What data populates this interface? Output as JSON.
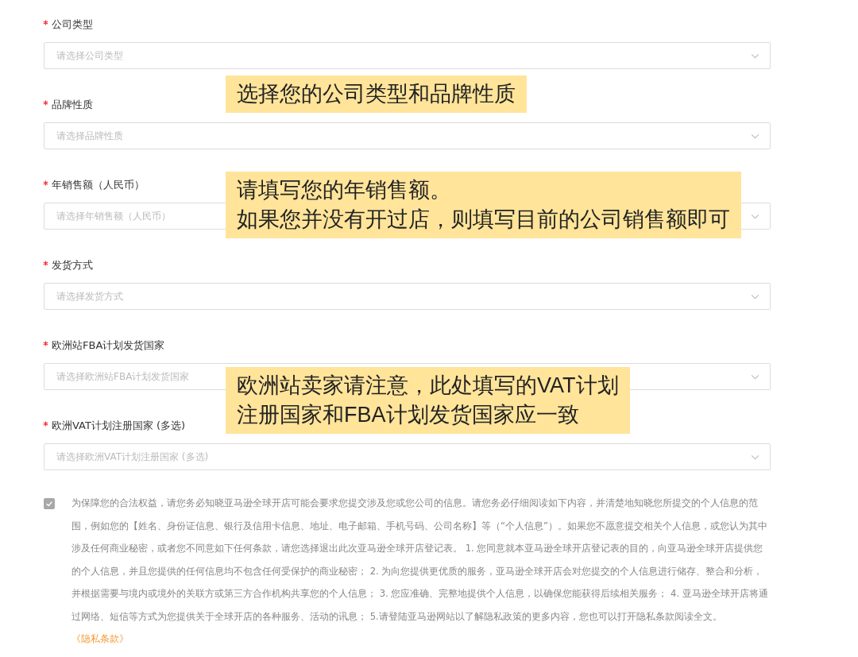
{
  "fields": [
    {
      "label": "公司类型",
      "placeholder": "请选择公司类型",
      "required": true
    },
    {
      "label": "品牌性质",
      "placeholder": "请选择品牌性质",
      "required": true
    },
    {
      "label": "年销售额（人民币）",
      "placeholder": "请选择年销售额（人民币）",
      "required": true
    },
    {
      "label": "发货方式",
      "placeholder": "请选择发货方式",
      "required": true
    },
    {
      "label": "欧洲站FBA计划发货国家",
      "placeholder": "请选择欧洲站FBA计划发货国家",
      "required": true
    },
    {
      "label": "欧洲VAT计划注册国家 (多选)",
      "placeholder": "请选择欧洲VAT计划注册国家 (多选)",
      "required": true
    }
  ],
  "consent": {
    "checked": true,
    "text": "为保障您的合法权益，请您务必知晓亚马逊全球开店可能会要求您提交涉及您或您公司的信息。请您务必仔细阅读如下内容，并清楚地知晓您所提交的个人信息的范围，例如您的【姓名、身份证信息、银行及信用卡信息、地址、电子邮箱、手机号码、公司名称】等（“个人信息”）。如果您不愿意提交相关个人信息，或您认为其中涉及任何商业秘密，或者您不同意如下任何条款，请您选择退出此次亚马逊全球开店登记表。 1. 您同意就本亚马逊全球开店登记表的目的，向亚马逊全球开店提供您的个人信息，并且您提供的任何信息均不包含任何受保护的商业秘密； 2. 为向您提供更优质的服务，亚马逊全球开店会对您提交的个人信息进行储存、整合和分析，并根据需要与境内或境外的关联方或第三方合作机构共享您的个人信息； 3. 您应准确、完整地提供个人信息，以确保您能获得后续相关服务； 4. 亚马逊全球开店将通过网络、短信等方式为您提供关于全球开店的各种服务、活动的讯息； 5.请登陆亚马逊网站以了解隐私政策的更多内容，您也可以打开隐私条款阅读全文。",
    "link": "《隐私条款》"
  },
  "notes": [
    {
      "lines": [
        "选择您的公司类型和品牌性质"
      ]
    },
    {
      "lines": [
        "请填写您的年销售额。",
        "如果您并没有开过店，则填写目前的公司销售额即可"
      ]
    },
    {
      "lines": [
        "欧洲站卖家请注意，此处填写的VAT计划",
        "注册国家和FBA计划发货国家应一致"
      ]
    }
  ]
}
